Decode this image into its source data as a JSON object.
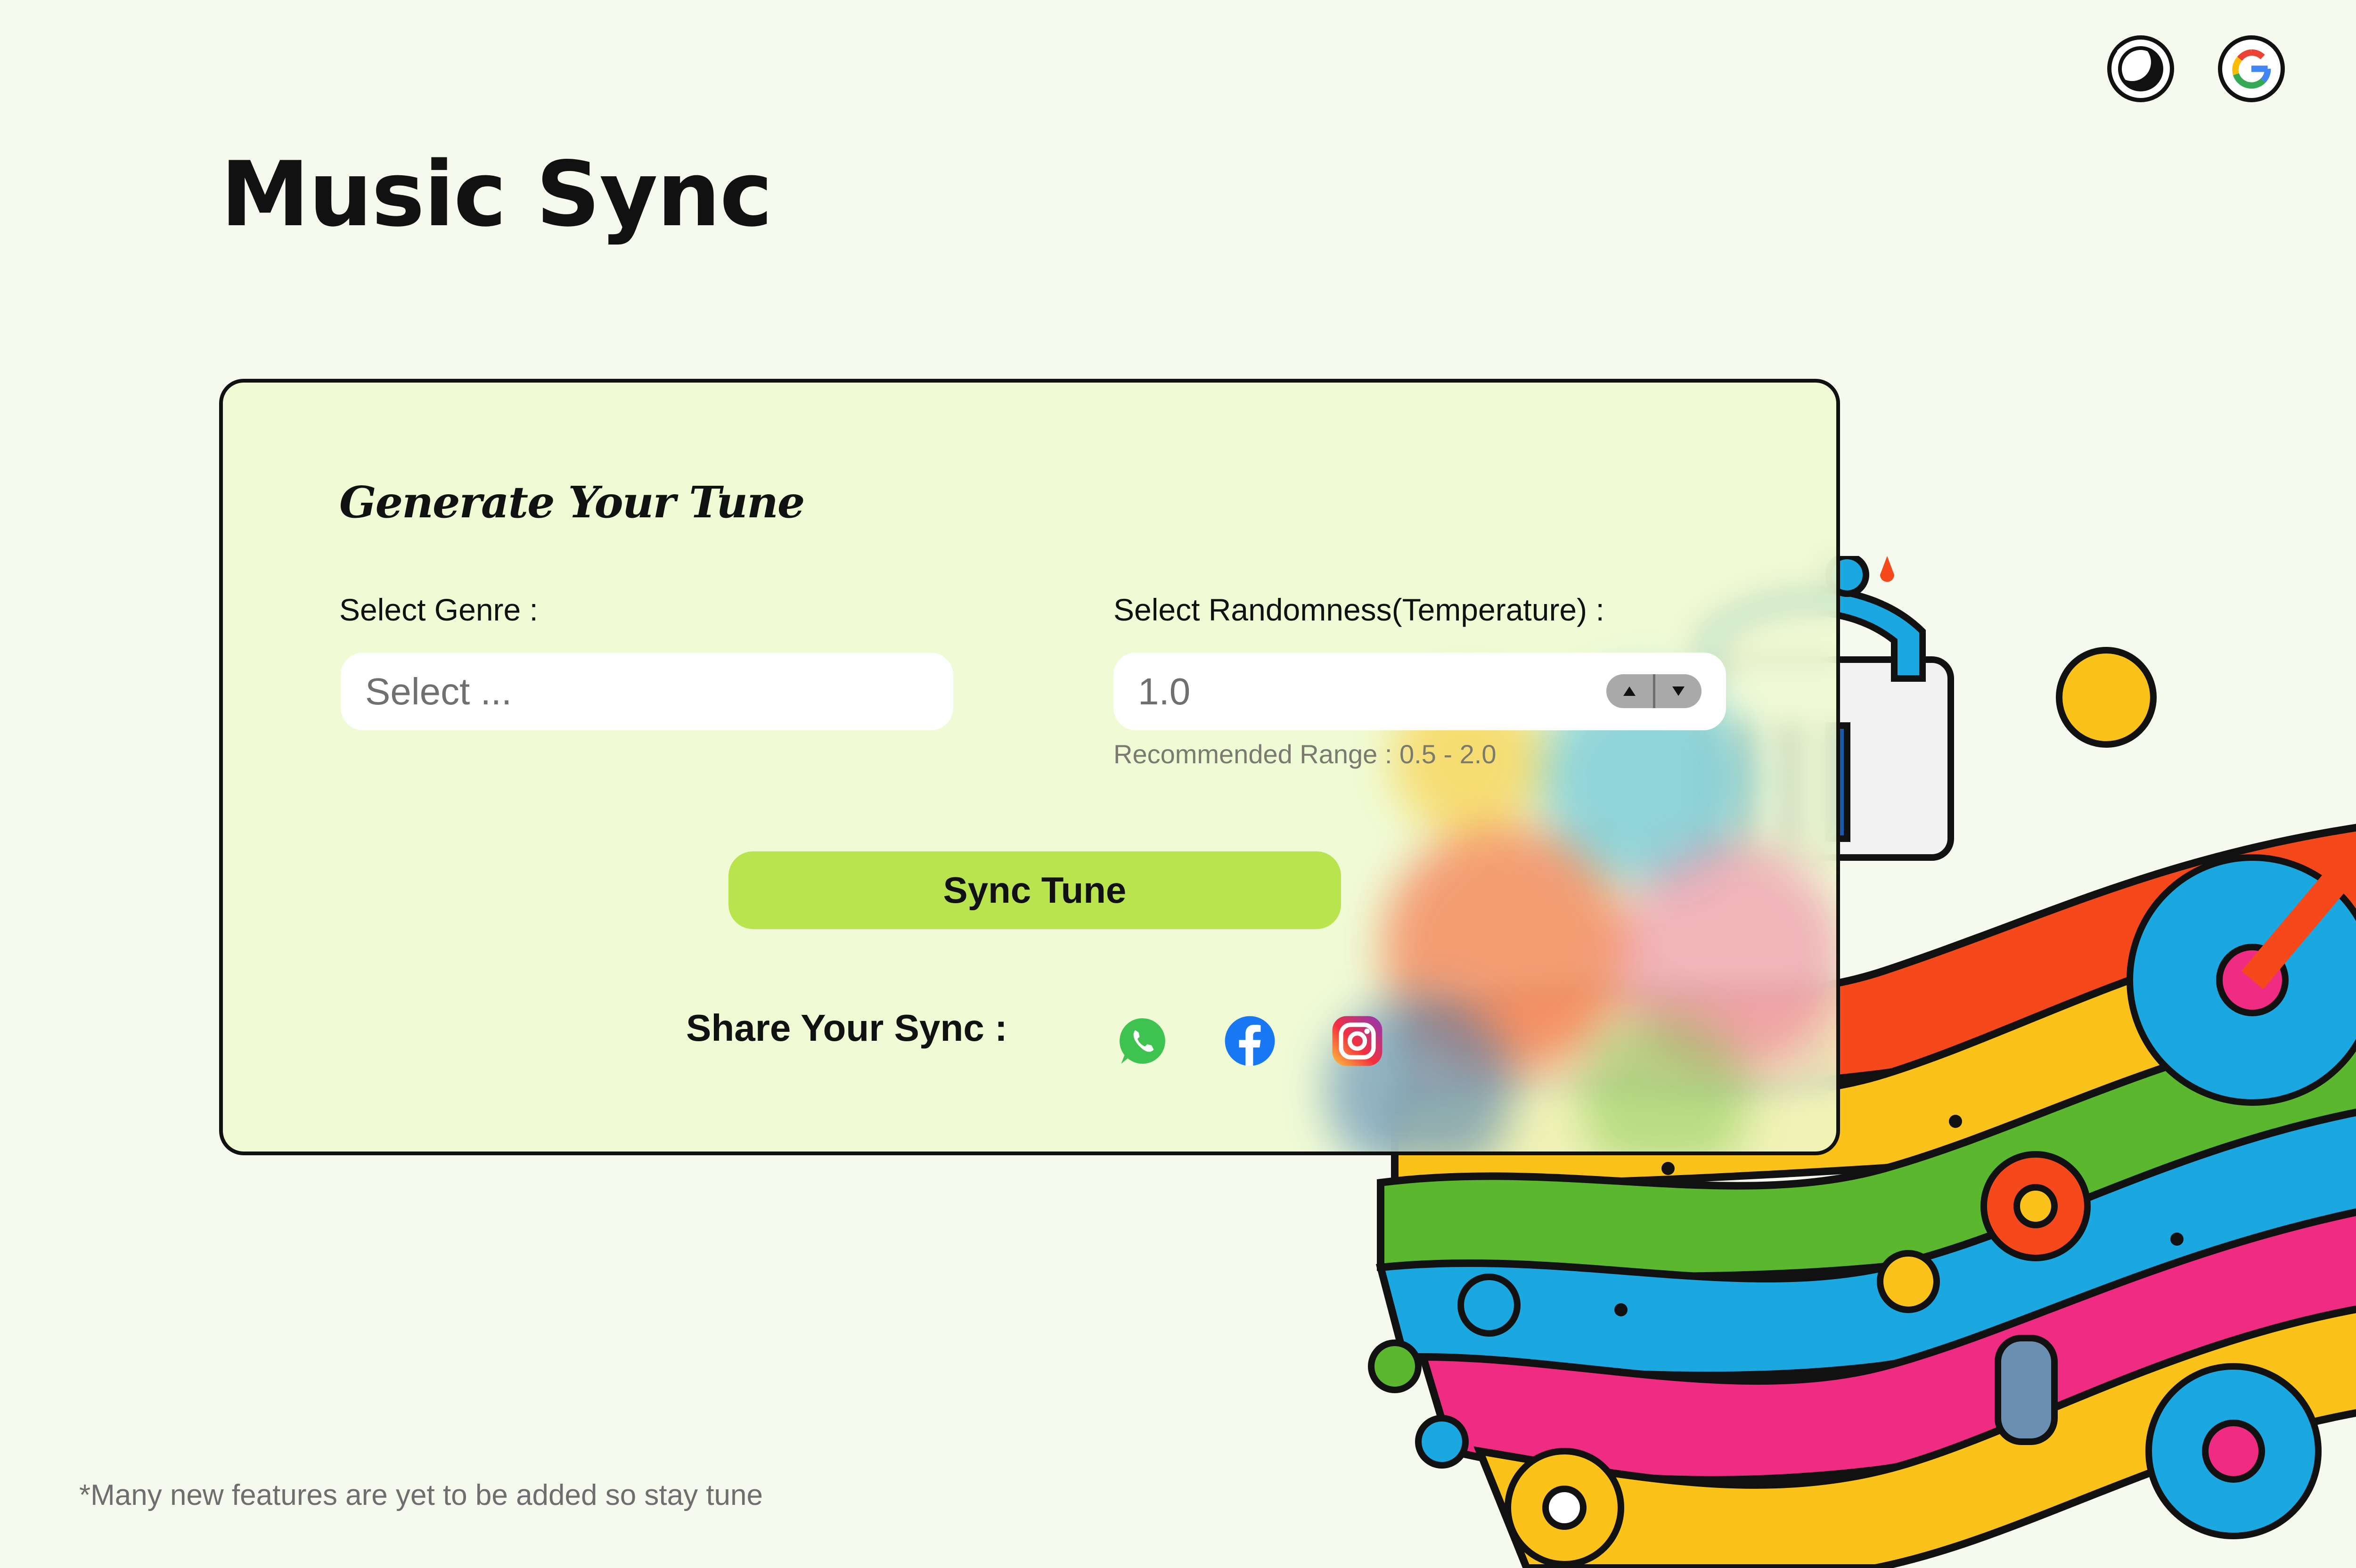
{
  "app": {
    "title": "Music Sync"
  },
  "header": {
    "theme_toggle_icon": "moon-icon",
    "signin_icon": "google-icon"
  },
  "generator": {
    "title": "Generate Your Tune",
    "genre_label": "Select Genre :",
    "genre_placeholder": "Select ...",
    "temperature_label": "Select Randomness(Temperature) :",
    "temperature_value": "1.0",
    "temperature_hint": "Recommended Range : 0.5 - 2.0",
    "submit_label": "Sync Tune"
  },
  "share": {
    "label": "Share Your Sync :",
    "icons": [
      "whatsapp-icon",
      "facebook-icon",
      "instagram-icon"
    ]
  },
  "footer": {
    "note": "*Many new features are yet to be added so stay tune"
  },
  "colors": {
    "background": "#f6faee",
    "card": "#effad0",
    "accent": "#b9e44e",
    "facebook": "#1877f2",
    "whatsapp": "#3fc350"
  }
}
